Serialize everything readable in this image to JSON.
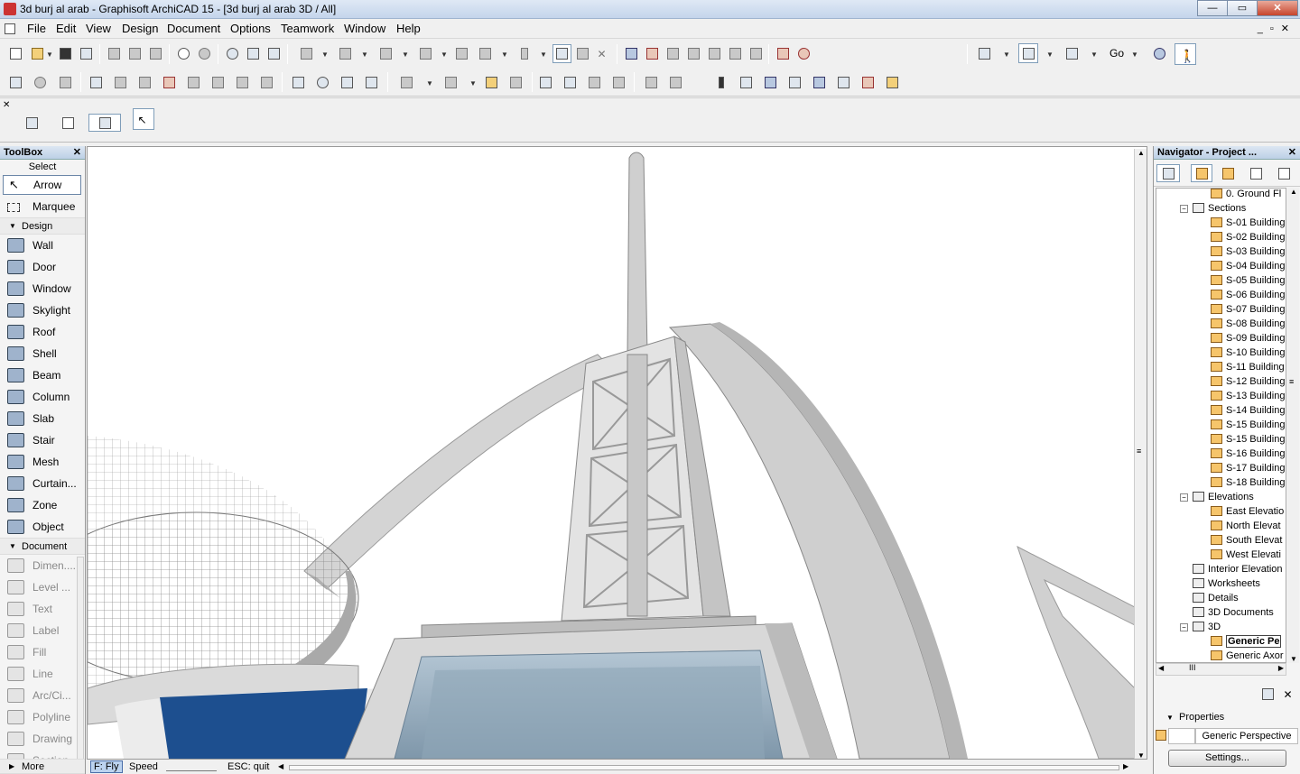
{
  "window": {
    "title": "3d burj al arab - Graphisoft ArchiCAD 15 - [3d burj al arab 3D / All]",
    "minimize": "—",
    "maximize": "▭",
    "close": "✕"
  },
  "menu": [
    "File",
    "Edit",
    "View",
    "Design",
    "Document",
    "Options",
    "Teamwork",
    "Window",
    "Help"
  ],
  "toolbar": {
    "go_label": "Go"
  },
  "toolbox": {
    "title": "ToolBox",
    "close": "✕",
    "select_label": "Select",
    "select_items": [
      {
        "label": "Arrow",
        "icon": "arrow-icon"
      },
      {
        "label": "Marquee",
        "icon": "marquee-icon"
      }
    ],
    "design_label": "Design",
    "design_items": [
      {
        "label": "Wall",
        "icon": "wall-icon"
      },
      {
        "label": "Door",
        "icon": "door-icon"
      },
      {
        "label": "Window",
        "icon": "window-icon"
      },
      {
        "label": "Skylight",
        "icon": "skylight-icon"
      },
      {
        "label": "Roof",
        "icon": "roof-icon"
      },
      {
        "label": "Shell",
        "icon": "shell-icon"
      },
      {
        "label": "Beam",
        "icon": "beam-icon"
      },
      {
        "label": "Column",
        "icon": "column-icon"
      },
      {
        "label": "Slab",
        "icon": "slab-icon"
      },
      {
        "label": "Stair",
        "icon": "stair-icon"
      },
      {
        "label": "Mesh",
        "icon": "mesh-icon"
      },
      {
        "label": "Curtain...",
        "icon": "curtain-wall-icon"
      },
      {
        "label": "Zone",
        "icon": "zone-icon"
      },
      {
        "label": "Object",
        "icon": "object-icon"
      }
    ],
    "document_label": "Document",
    "document_items": [
      {
        "label": "Dimen....",
        "icon": "dimension-icon"
      },
      {
        "label": "Level ...",
        "icon": "level-dimension-icon"
      },
      {
        "label": "Text",
        "icon": "text-icon"
      },
      {
        "label": "Label",
        "icon": "label-icon"
      },
      {
        "label": "Fill",
        "icon": "fill-icon"
      },
      {
        "label": "Line",
        "icon": "line-icon"
      },
      {
        "label": "Arc/Ci...",
        "icon": "arc-circle-icon"
      },
      {
        "label": "Polyline",
        "icon": "polyline-icon"
      },
      {
        "label": "Drawing",
        "icon": "drawing-icon"
      },
      {
        "label": "Section",
        "icon": "section-icon"
      }
    ],
    "more_label": "More"
  },
  "status": {
    "fly": "F: Fly",
    "speed": "Speed",
    "esc": "ESC: quit"
  },
  "navigator": {
    "title": "Navigator - Project ...",
    "close": "✕",
    "tree": [
      {
        "label": "0. Ground Fl",
        "type": "story",
        "level": 3
      },
      {
        "label": "Sections",
        "type": "folder",
        "level": 2,
        "expand": "−"
      },
      {
        "label": "S-01 Building",
        "type": "view",
        "level": 3
      },
      {
        "label": "S-02 Building",
        "type": "view",
        "level": 3
      },
      {
        "label": "S-03 Building",
        "type": "view",
        "level": 3
      },
      {
        "label": "S-04 Building",
        "type": "view",
        "level": 3
      },
      {
        "label": "S-05 Building",
        "type": "view",
        "level": 3
      },
      {
        "label": "S-06 Building",
        "type": "view",
        "level": 3
      },
      {
        "label": "S-07 Building",
        "type": "view",
        "level": 3
      },
      {
        "label": "S-08 Building",
        "type": "view",
        "level": 3
      },
      {
        "label": "S-09 Building",
        "type": "view",
        "level": 3
      },
      {
        "label": "S-10 Building",
        "type": "view",
        "level": 3
      },
      {
        "label": "S-11 Building",
        "type": "view",
        "level": 3
      },
      {
        "label": "S-12 Building",
        "type": "view",
        "level": 3
      },
      {
        "label": "S-13 Building",
        "type": "view",
        "level": 3
      },
      {
        "label": "S-14 Building",
        "type": "view",
        "level": 3
      },
      {
        "label": "S-15 Building",
        "type": "view",
        "level": 3
      },
      {
        "label": "S-15 Building",
        "type": "view",
        "level": 3
      },
      {
        "label": "S-16 Building",
        "type": "view",
        "level": 3
      },
      {
        "label": "S-17 Building",
        "type": "view",
        "level": 3
      },
      {
        "label": "S-18 Building",
        "type": "view",
        "level": 3
      },
      {
        "label": "Elevations",
        "type": "folder",
        "level": 2,
        "expand": "−"
      },
      {
        "label": "East Elevatio",
        "type": "view",
        "level": 3
      },
      {
        "label": "North Elevat",
        "type": "view",
        "level": 3
      },
      {
        "label": "South Elevat",
        "type": "view",
        "level": 3
      },
      {
        "label": "West Elevati",
        "type": "view",
        "level": 3
      },
      {
        "label": "Interior Elevation",
        "type": "folder",
        "level": 2
      },
      {
        "label": "Worksheets",
        "type": "folder",
        "level": 2
      },
      {
        "label": "Details",
        "type": "folder",
        "level": 2
      },
      {
        "label": "3D Documents",
        "type": "folder",
        "level": 2
      },
      {
        "label": "3D",
        "type": "folder",
        "level": 2,
        "expand": "−"
      },
      {
        "label": "Generic Pe",
        "type": "view",
        "level": 3,
        "selected": true
      },
      {
        "label": "Generic Axor",
        "type": "view",
        "level": 3
      }
    ],
    "properties_label": "Properties",
    "properties_value": "Generic Perspective",
    "settings_label": "Settings..."
  }
}
